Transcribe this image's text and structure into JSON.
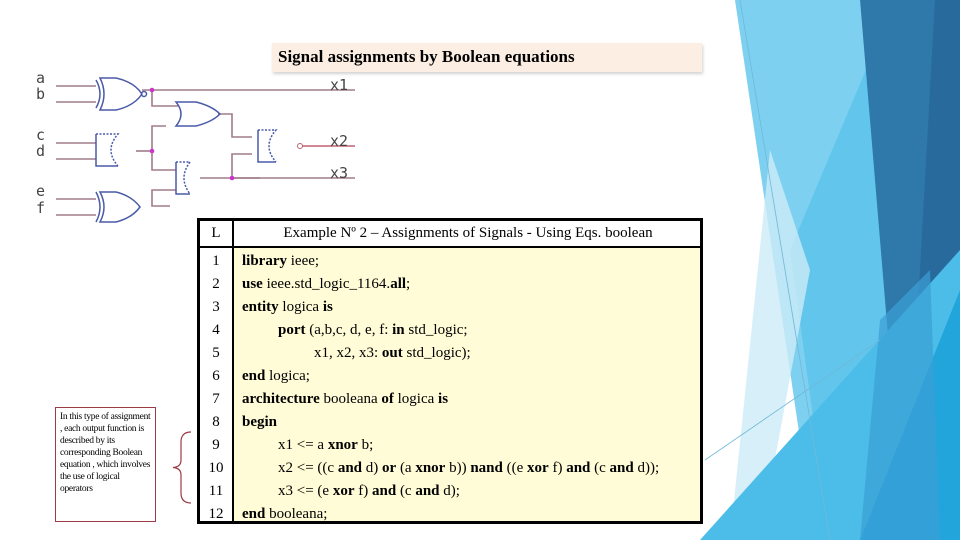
{
  "slide": {
    "title": "Signal assignments by Boolean equations",
    "colors": {
      "title_banner_bg": "#fdeee3",
      "code_bg": "#fffcd7",
      "note_border": "#9b3b45",
      "wire": "#a07b8a",
      "gate": "#4a5aa8",
      "junction": "#cc33cc",
      "accent_light": "#7ed0f0",
      "accent_mid": "#3eb5e3",
      "accent_dark": "#2a6d9e"
    }
  },
  "circuit": {
    "inputs": [
      "a",
      "b",
      "c",
      "d",
      "e",
      "f"
    ],
    "outputs": [
      "x1",
      "x2",
      "x3"
    ],
    "gates": [
      "xnor",
      "and",
      "or",
      "nand",
      "xor",
      "and"
    ]
  },
  "note": {
    "text": "In this type of assignment , each output function is described by its corresponding Boolean equation , which involves the use of logical operators"
  },
  "table": {
    "header_line": "L",
    "header_title": "Example Nº 2 – Assignments of Signals - Using Eqs. boolean",
    "lines": [
      {
        "n": "1",
        "indent": 0,
        "tokens": [
          {
            "t": "library",
            "b": true
          },
          {
            "t": " ieee;",
            "b": false
          }
        ]
      },
      {
        "n": "2",
        "indent": 0,
        "tokens": [
          {
            "t": "use",
            "b": true
          },
          {
            "t": " ieee.std_logic_1164.",
            "b": false
          },
          {
            "t": "all",
            "b": true
          },
          {
            "t": ";",
            "b": false
          }
        ]
      },
      {
        "n": "3",
        "indent": 0,
        "tokens": [
          {
            "t": "entity",
            "b": true
          },
          {
            "t": " logica ",
            "b": false
          },
          {
            "t": "is",
            "b": true
          }
        ]
      },
      {
        "n": "4",
        "indent": 1,
        "tokens": [
          {
            "t": "port",
            "b": true
          },
          {
            "t": " (a,b,c, d, e, f: ",
            "b": false
          },
          {
            "t": "in",
            "b": true
          },
          {
            "t": " std_logic;",
            "b": false
          }
        ]
      },
      {
        "n": "5",
        "indent": 2,
        "tokens": [
          {
            "t": "x1, x2, x3: ",
            "b": false
          },
          {
            "t": "out",
            "b": true
          },
          {
            "t": " std_logic);",
            "b": false
          }
        ]
      },
      {
        "n": "6",
        "indent": 0,
        "tokens": [
          {
            "t": "end",
            "b": true
          },
          {
            "t": " logica;",
            "b": false
          }
        ]
      },
      {
        "n": "7",
        "indent": 0,
        "tokens": [
          {
            "t": "architecture",
            "b": true
          },
          {
            "t": " booleana ",
            "b": false
          },
          {
            "t": "of",
            "b": true
          },
          {
            "t": " logica ",
            "b": false
          },
          {
            "t": "is",
            "b": true
          }
        ]
      },
      {
        "n": "8",
        "indent": 0,
        "tokens": [
          {
            "t": "begin",
            "b": true
          }
        ]
      },
      {
        "n": "9",
        "indent": 1,
        "tokens": [
          {
            "t": "x1 <= a ",
            "b": false
          },
          {
            "t": "xnor",
            "b": true
          },
          {
            "t": " b;",
            "b": false
          }
        ]
      },
      {
        "n": "10",
        "indent": 1,
        "tokens": [
          {
            "t": "x2 <= ((c ",
            "b": false
          },
          {
            "t": "and",
            "b": true
          },
          {
            "t": " d) ",
            "b": false
          },
          {
            "t": "or",
            "b": true
          },
          {
            "t": " (a ",
            "b": false
          },
          {
            "t": "xnor",
            "b": true
          },
          {
            "t": " b)) ",
            "b": false
          },
          {
            "t": "nand",
            "b": true
          },
          {
            "t": " ((e ",
            "b": false
          },
          {
            "t": "xor",
            "b": true
          },
          {
            "t": " f) ",
            "b": false
          },
          {
            "t": "and",
            "b": true
          },
          {
            "t": " (c ",
            "b": false
          },
          {
            "t": "and",
            "b": true
          },
          {
            "t": " d));",
            "b": false
          }
        ]
      },
      {
        "n": "11",
        "indent": 1,
        "tokens": [
          {
            "t": "x3 <= (e ",
            "b": false
          },
          {
            "t": "xor",
            "b": true
          },
          {
            "t": " f) ",
            "b": false
          },
          {
            "t": "and",
            "b": true
          },
          {
            "t": " (c ",
            "b": false
          },
          {
            "t": "and",
            "b": true
          },
          {
            "t": " d);",
            "b": false
          }
        ]
      },
      {
        "n": "12",
        "indent": 0,
        "tokens": [
          {
            "t": "end",
            "b": true
          },
          {
            "t": " booleana;",
            "b": false
          }
        ]
      }
    ]
  }
}
